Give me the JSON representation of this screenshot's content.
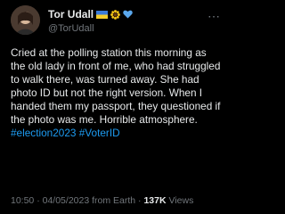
{
  "author": {
    "display_name": "Tor Udall",
    "handle": "@TorUdall",
    "name_emojis": [
      "ukraine-flag-icon",
      "sunflower-icon",
      "blue-heart-icon"
    ]
  },
  "more_icon": "⋯",
  "tweet": {
    "text": "Cried at the polling station this morning as the old lady in front of me, who had struggled to walk there, was turned away. She had photo ID but not the right version. When I handed them my passport, they questioned if the photo was me. Horrible atmosphere.",
    "hashtags": [
      "#election2023",
      "#VoterID"
    ]
  },
  "meta": {
    "time": "10:50",
    "separator": "·",
    "date": "04/05/2023",
    "source": "from Earth",
    "views_count": "137K",
    "views_label": "Views"
  },
  "colors": {
    "background": "#000000",
    "text": "#e7e9ea",
    "secondary": "#71767b",
    "link": "#1d9bf0"
  }
}
